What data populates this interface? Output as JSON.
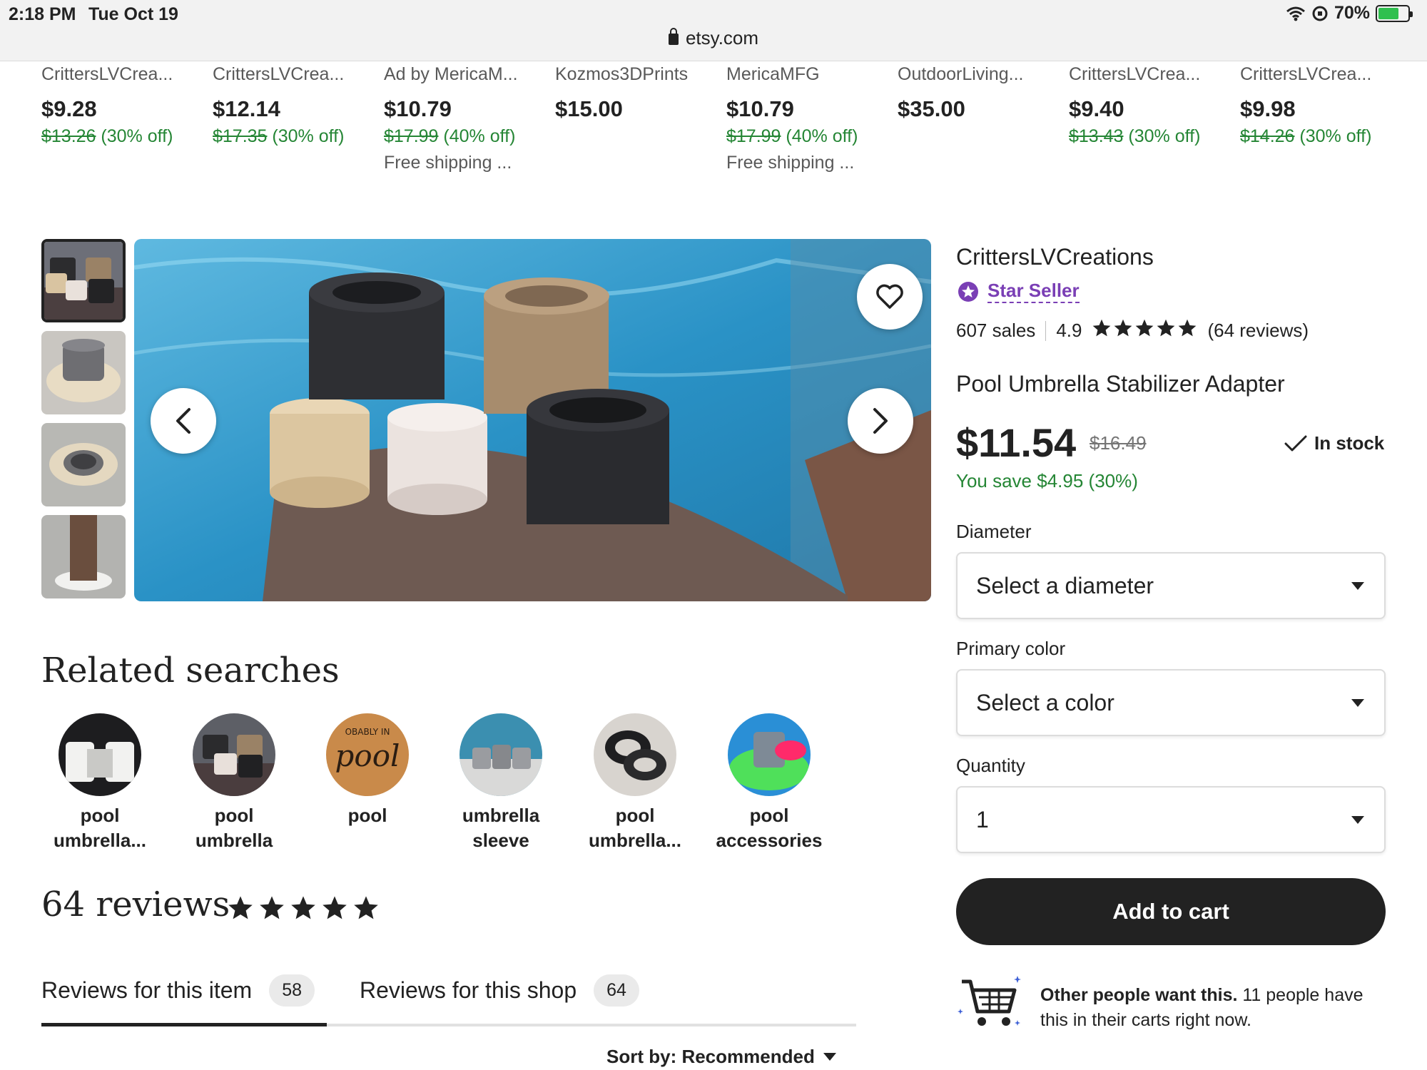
{
  "status": {
    "time": "2:18 PM",
    "date": "Tue Oct 19",
    "battery": "70%",
    "battery_level": 0.7,
    "url": "etsy.com"
  },
  "strip": [
    {
      "shop": "CrittersLVCrea...",
      "price": "$9.28",
      "orig": "$13.26",
      "off": "(30% off)",
      "ship": ""
    },
    {
      "shop": "CrittersLVCrea...",
      "price": "$12.14",
      "orig": "$17.35",
      "off": "(30% off)",
      "ship": ""
    },
    {
      "shop": "Ad by MericaM...",
      "price": "$10.79",
      "orig": "$17.99",
      "off": "(40% off)",
      "ship": "Free shipping ..."
    },
    {
      "shop": "Kozmos3DPrints",
      "price": "$15.00",
      "orig": "",
      "off": "",
      "ship": ""
    },
    {
      "shop": "MericaMFG",
      "price": "$10.79",
      "orig": "$17.99",
      "off": "(40% off)",
      "ship": "Free shipping ..."
    },
    {
      "shop": "OutdoorLiving...",
      "price": "$35.00",
      "orig": "",
      "off": "",
      "ship": ""
    },
    {
      "shop": "CrittersLVCrea...",
      "price": "$9.40",
      "orig": "$13.43",
      "off": "(30% off)",
      "ship": ""
    },
    {
      "shop": "CrittersLVCrea...",
      "price": "$9.98",
      "orig": "$14.26",
      "off": "(30% off)",
      "ship": ""
    }
  ],
  "related": {
    "title": "Related searches",
    "items": [
      {
        "line1": "pool",
        "line2": "umbrella..."
      },
      {
        "line1": "pool",
        "line2": "umbrella"
      },
      {
        "line1": "pool",
        "line2": ""
      },
      {
        "line1": "umbrella",
        "line2": "sleeve"
      },
      {
        "line1": "pool",
        "line2": "umbrella..."
      },
      {
        "line1": "pool",
        "line2": "accessories"
      }
    ]
  },
  "reviews": {
    "title": "64 reviews",
    "rating_stars": 5,
    "tab_item_label": "Reviews for this item",
    "tab_item_count": "58",
    "tab_shop_label": "Reviews for this shop",
    "tab_shop_count": "64",
    "sort_label": "Sort by: Recommended"
  },
  "product": {
    "shop": "CrittersLVCreations",
    "star_seller": "Star Seller",
    "sales": "607 sales",
    "rating": "4.9",
    "review_count": "(64 reviews)",
    "title": "Pool Umbrella Stabilizer Adapter",
    "price": "$11.54",
    "orig_price": "$16.49",
    "stock": "In stock",
    "savings": "You save $4.95 (30%)",
    "diameter_label": "Diameter",
    "diameter_value": "Select a diameter",
    "color_label": "Primary color",
    "color_value": "Select a color",
    "quantity_label": "Quantity",
    "quantity_value": "1",
    "add_to_cart": "Add to cart",
    "notice_bold": "Other people want this.",
    "notice_rest": " 11 people have this in their carts right now."
  },
  "colors": {
    "discount_green": "#258635",
    "star_seller_purple": "#7a3fb5",
    "dark": "#222222",
    "battery_green": "#30c04f"
  }
}
